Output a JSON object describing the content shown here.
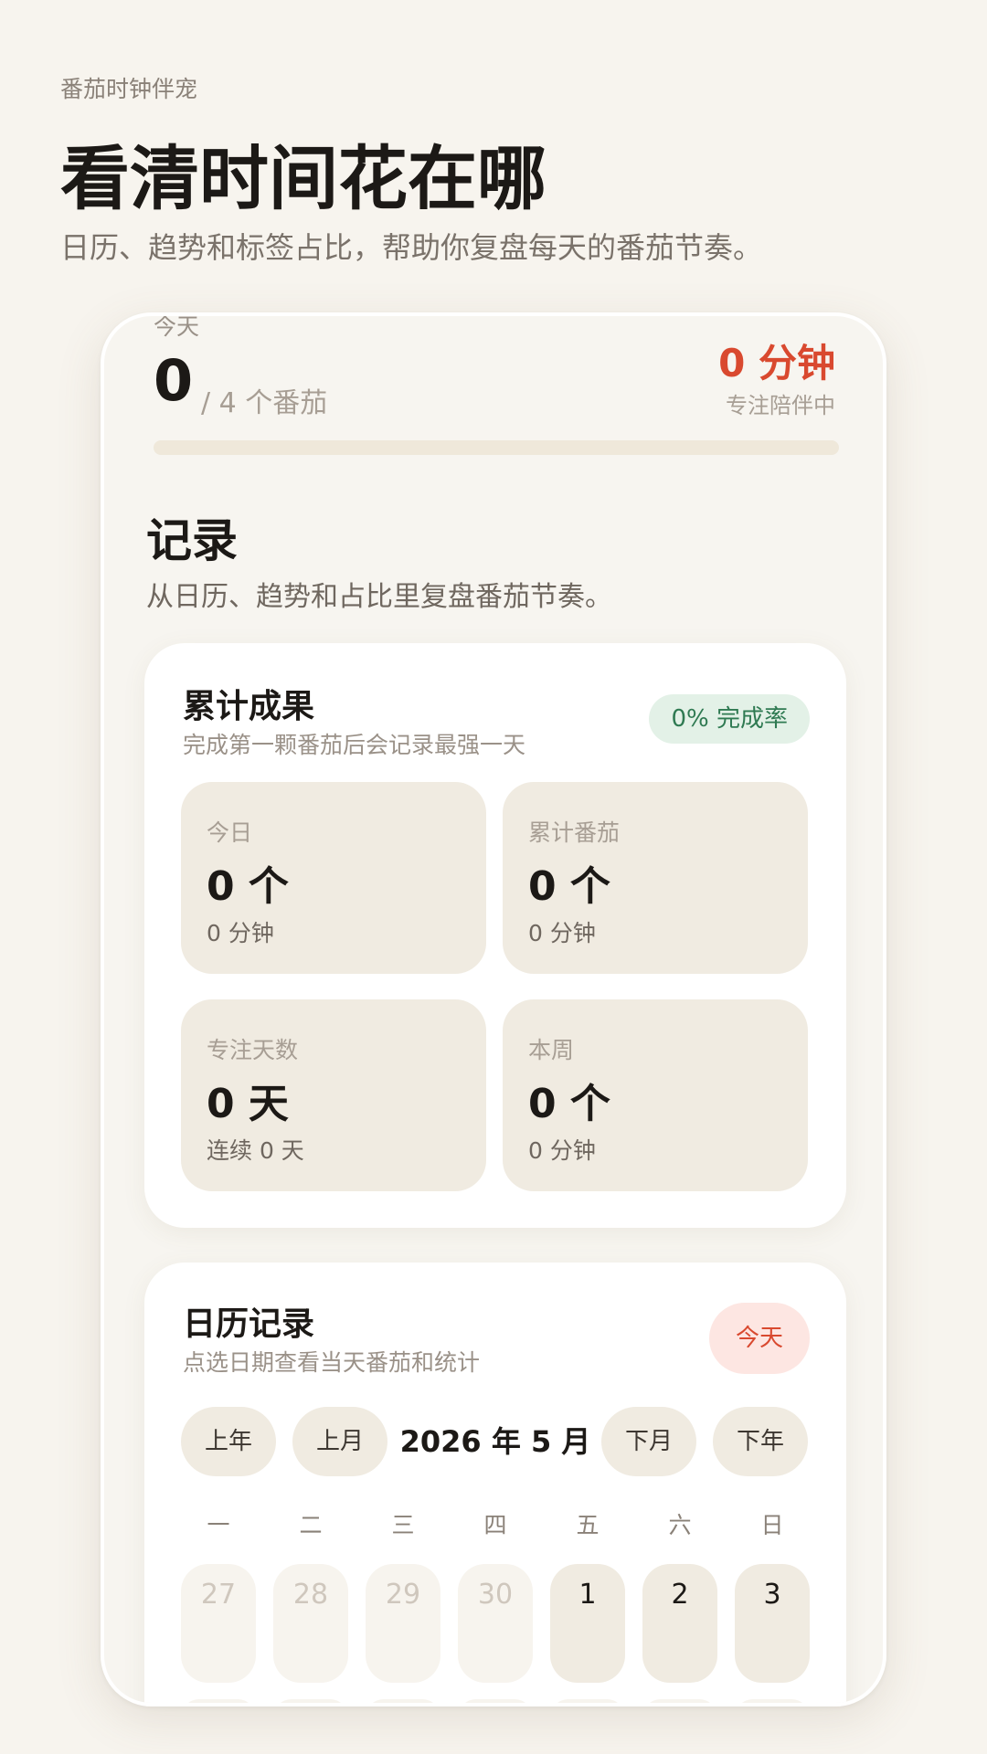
{
  "hero": {
    "kicker": "番茄时钟伴宠",
    "title": "看清时间花在哪",
    "subtitle": "日历、趋势和标签占比，帮助你复盘每天的番茄节奏。"
  },
  "today_bar": {
    "label": "今天",
    "count": "0",
    "goal": "/ 4 个番茄",
    "minutes": "0 分钟",
    "minutes_sub": "专注陪伴中",
    "progress_fraction": 0
  },
  "records": {
    "title": "记录",
    "subtitle": "从日历、趋势和占比里复盘番茄节奏。"
  },
  "summary_card": {
    "title": "累计成果",
    "subtitle": "完成第一颗番茄后会记录最强一天",
    "badge": "0% 完成率",
    "stats": [
      {
        "label": "今日",
        "value": "0 个",
        "detail": "0 分钟"
      },
      {
        "label": "累计番茄",
        "value": "0 个",
        "detail": "0 分钟"
      },
      {
        "label": "专注天数",
        "value": "0 天",
        "detail": "连续 0 天"
      },
      {
        "label": "本周",
        "value": "0 个",
        "detail": "0 分钟"
      }
    ]
  },
  "calendar_card": {
    "title": "日历记录",
    "subtitle": "点选日期查看当天番茄和统计",
    "today_button": "今天",
    "prev_year": "上年",
    "prev_month": "上月",
    "month_label": "2026 年 5 月",
    "next_month": "下月",
    "next_year": "下年",
    "weekdays": [
      "一",
      "二",
      "三",
      "四",
      "五",
      "六",
      "日"
    ],
    "first_row": [
      {
        "day": "27",
        "in_month": false
      },
      {
        "day": "28",
        "in_month": false
      },
      {
        "day": "29",
        "in_month": false
      },
      {
        "day": "30",
        "in_month": false
      },
      {
        "day": "1",
        "in_month": true
      },
      {
        "day": "2",
        "in_month": true
      },
      {
        "day": "3",
        "in_month": true
      }
    ]
  },
  "colors": {
    "accent": "#d9492f",
    "success": "#2f7a52",
    "background": "#f7f4ee",
    "tile": "#f0ebe1"
  }
}
